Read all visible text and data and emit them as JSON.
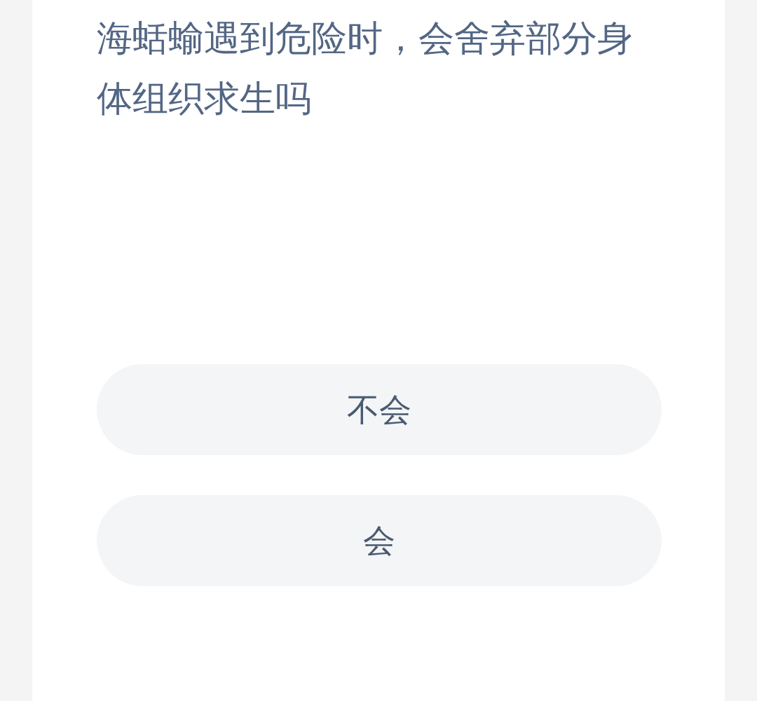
{
  "question": "海蛞蝓遇到危险时，会舍弃部分身体组织求生吗",
  "options": [
    {
      "label": "不会"
    },
    {
      "label": "会"
    }
  ]
}
